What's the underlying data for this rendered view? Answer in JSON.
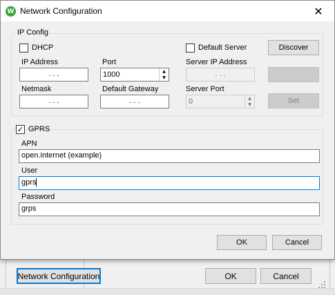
{
  "parent_window": {
    "network_button": "Network Configuration",
    "ok_button": "OK",
    "cancel_button": "Cancel"
  },
  "dialog": {
    "title": "Network Configuration",
    "app_icon": "app-logo-icon",
    "close_glyph": "✕",
    "ip_config": {
      "legend": "IP Config",
      "dhcp_label": "DHCP",
      "dhcp_checked": false,
      "default_server_label": "Default Server",
      "default_server_checked": false,
      "discover_button": "Discover",
      "ip_address_label": "IP Address",
      "ip_address_value": ". . .",
      "port_label": "Port",
      "port_value": "1000",
      "server_ip_label": "Server IP Address",
      "server_ip_value": ". . .",
      "netmask_label": "Netmask",
      "netmask_value": ". . .",
      "gateway_label": "Default Gateway",
      "gateway_value": ". . .",
      "server_port_label": "Server Port",
      "server_port_value": "0",
      "set_button": "Set"
    },
    "gprs": {
      "legend": "GPRS",
      "checked": true,
      "check_glyph": "✓",
      "apn_label": "APN",
      "apn_value": "open.internet (example)",
      "user_label": "User",
      "user_value": "gprs",
      "password_label": "Password",
      "password_value": "grps"
    },
    "ok_button": "OK",
    "cancel_button": "Cancel"
  }
}
